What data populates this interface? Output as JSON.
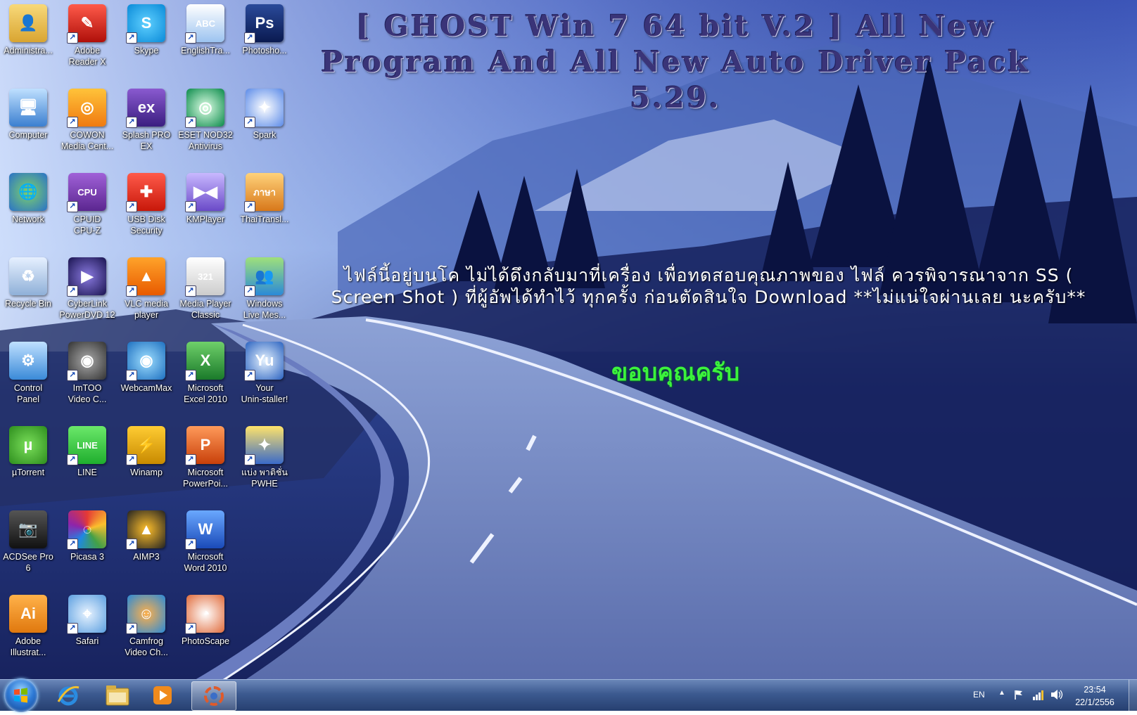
{
  "headline": "[ GHOST Win 7 64 bit V.2 ] All New Program And All New Auto Driver Pack 5.29.",
  "notice": "ไฟล์นี้อยู่บนโค ไม่ได้ดึงกลับมาที่เครื่อง เพื่อทดสอบคุณภาพของ ไฟล์ ควรพิจารณาจาก SS ( Screen Shot ) ที่ผู้อัพได้ทำไว้ ทุกครั้ง ก่อนตัดสินใจ Download **ไม่แน่ใจผ่านเลย นะครับ**",
  "thanks": "ขอบคุณครับ",
  "desktop": {
    "col1": [
      {
        "label": "Administra...",
        "icon": "user-folder-icon"
      },
      {
        "label": "Computer",
        "icon": "computer-icon"
      },
      {
        "label": "Network",
        "icon": "network-icon"
      },
      {
        "label": "Recycle Bin",
        "icon": "recycle-bin-icon"
      },
      {
        "label": "Control\nPanel",
        "icon": "control-panel-icon"
      },
      {
        "label": "µTorrent",
        "icon": "utorrent-icon"
      },
      {
        "label": "ACDSee Pro\n6",
        "icon": "acdsee-icon"
      },
      {
        "label": "Adobe\nIllustrat...",
        "icon": "illustrator-icon"
      }
    ],
    "col2": [
      {
        "label": "Adobe\nReader X",
        "icon": "adobe-reader-icon"
      },
      {
        "label": "COWON\nMedia Cent...",
        "icon": "cowon-icon"
      },
      {
        "label": "CPUID\nCPU-Z",
        "icon": "cpuz-icon"
      },
      {
        "label": "CyberLink\nPowerDVD 12",
        "icon": "powerdvd-icon"
      },
      {
        "label": "ImTOO\nVideo C...",
        "icon": "imtoo-icon"
      },
      {
        "label": "LINE",
        "icon": "line-icon"
      },
      {
        "label": "Picasa 3",
        "icon": "picasa-icon"
      },
      {
        "label": "Safari",
        "icon": "safari-icon"
      }
    ],
    "col3": [
      {
        "label": "Skype",
        "icon": "skype-icon"
      },
      {
        "label": "Splash PRO\nEX",
        "icon": "splash-icon"
      },
      {
        "label": "USB Disk\nSecurity",
        "icon": "usb-security-icon"
      },
      {
        "label": "VLC media\nplayer",
        "icon": "vlc-icon"
      },
      {
        "label": "WebcamMax",
        "icon": "webcammax-icon"
      },
      {
        "label": "Winamp",
        "icon": "winamp-icon"
      },
      {
        "label": "AIMP3",
        "icon": "aimp-icon"
      },
      {
        "label": "Camfrog\nVideo Ch...",
        "icon": "camfrog-icon"
      }
    ],
    "col4": [
      {
        "label": "EnglishTra...",
        "icon": "english-translator-icon"
      },
      {
        "label": "ESET NOD32\nAntivirus",
        "icon": "eset-icon"
      },
      {
        "label": "KMPlayer",
        "icon": "kmplayer-icon"
      },
      {
        "label": "Media Player\nClassic",
        "icon": "mpc-icon"
      },
      {
        "label": "Microsoft\nExcel 2010",
        "icon": "excel-icon"
      },
      {
        "label": "Microsoft\nPowerPoi...",
        "icon": "powerpoint-icon"
      },
      {
        "label": "Microsoft\nWord 2010",
        "icon": "word-icon"
      },
      {
        "label": "PhotoScape",
        "icon": "photoscape-icon"
      }
    ],
    "col5": [
      {
        "label": "Photosho...",
        "icon": "photoshop-icon"
      },
      {
        "label": "Spark",
        "icon": "spark-icon"
      },
      {
        "label": "ThaiTransl...",
        "icon": "thai-translator-icon"
      },
      {
        "label": "Windows\nLive Mes...",
        "icon": "live-messenger-icon"
      },
      {
        "label": "Your\nUnin-staller!",
        "icon": "uninstaller-icon"
      },
      {
        "label": "แบ่ง พาติชั่น\nPWHE",
        "icon": "partition-icon"
      }
    ]
  },
  "icon_glyphs": {
    "english-translator": "ABC",
    "photoshop": "Ps",
    "cpuz": "CPU-Z",
    "illustrator": "Ai",
    "line": "LINE",
    "splash": "ex",
    "uninstaller": "Yu",
    "thai": "ภาษา"
  },
  "taskbar": {
    "lang": "EN",
    "time": "23:54",
    "date": "22/1/2556",
    "pinned": [
      "internet-explorer-icon",
      "windows-explorer-icon",
      "media-player-icon",
      "photoscape-icon"
    ]
  }
}
